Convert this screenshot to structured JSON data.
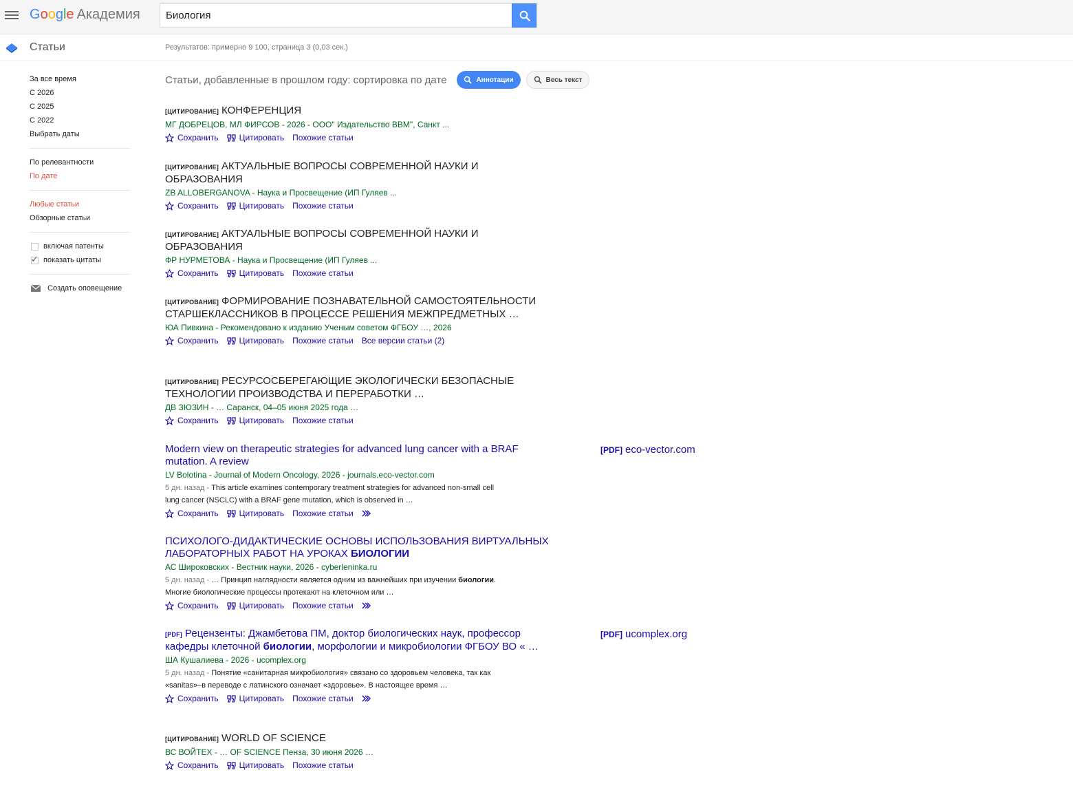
{
  "header": {
    "logo_google": "Google",
    "logo_academy": "Академия",
    "search_value": "Биология"
  },
  "subheader": {
    "title": "Статьи",
    "stats": "Результатов: примерно 9 100, страница 3 (0,03 сек.)"
  },
  "sidebar": {
    "time_items": [
      "За все время",
      "С 2026",
      "С 2025",
      "С 2022",
      "Выбрать даты"
    ],
    "sort_items": [
      "По релевантности",
      "По дате"
    ],
    "type_items": [
      "Любые статьи",
      "Обзорные статьи"
    ],
    "checkboxes": [
      {
        "label": "включая патенты",
        "checked": false
      },
      {
        "label": "показать цитаты",
        "checked": true
      }
    ],
    "alert": "Создать оповещение"
  },
  "sort_line": {
    "text": "Статьи, добавленные в прошлом году: сортировка по дате",
    "abstracts": "Аннотации",
    "fulltext": "Весь текст"
  },
  "actions": {
    "save": "Сохранить",
    "cite": "Цитировать",
    "related": "Похожие статьи",
    "versions": "Все версии статьи (2)"
  },
  "results": [
    {
      "tag": "[ЦИТИРОВАНИЕ]",
      "title": "КОНФЕРЕНЦИЯ",
      "meta": "МГ ДОБРЕЦОВ, МЛ ФИРСОВ - 2026 - ООО\" Издательство ВВМ\", Санкт ..."
    },
    {
      "tag": "[ЦИТИРОВАНИЕ]",
      "title": "АКТУАЛЬНЫЕ ВОПРОСЫ СОВРЕМЕННОЙ НАУКИ И ОБРАЗОВАНИЯ",
      "meta": "ZB ALLOBERGANOVA - Наука и Просвещение (ИП Гуляев ..."
    },
    {
      "tag": "[ЦИТИРОВАНИЕ]",
      "title": "АКТУАЛЬНЫЕ ВОПРОСЫ СОВРЕМЕННОЙ НАУКИ И ОБРАЗОВАНИЯ",
      "meta": "ФР НУРМЕТОВА - Наука и Просвещение (ИП Гуляев ..."
    },
    {
      "tag": "[ЦИТИРОВАНИЕ]",
      "title": "ФОРМИРОВАНИЕ ПОЗНАВАТЕЛЬНОЙ САМОСТОЯТЕЛЬНОСТИ СТАРШЕКЛАССНИКОВ В ПРОЦЕССЕ РЕШЕНИЯ МЕЖПРЕДМЕТНЫХ …",
      "meta": "ЮА Пивкина - Рекомендовано к изданию Ученым советом ФГБОУ …, 2026"
    },
    {
      "tag": "[ЦИТИРОВАНИЕ]",
      "title": "РЕСУРСОСБЕРЕГАЮЩИЕ ЭКОЛОГИЧЕСКИ БЕЗОПАСНЫЕ ТЕХНОЛОГИИ ПРОИЗВОДСТВА И ПЕРЕРАБОТКИ …",
      "meta": "ДВ ЗЮЗИН - … Саранск, 04–05 июня 2025 года …"
    },
    {
      "title": "Modern view on therapeutic strategies for advanced lung cancer with a BRAF mutation. A review",
      "meta": "LV Bolotina - Journal of Modern Oncology, 2026 - journals.eco-vector.com",
      "date": "5 дн. назад - ",
      "snippet": "This article examines contemporary treatment strategies for advanced non-small cell lung cancer (NSCLC) with a BRAF gene mutation, which is observed in …",
      "side_pdf": "[PDF]",
      "side_domain": "eco-vector.com"
    },
    {
      "title_a": "ПСИХОЛОГО-ДИДАКТИЧЕСКИЕ ОСНОВЫ ИСПОЛЬЗОВАНИЯ ВИРТУАЛЬНЫХ ЛАБОРАТОРНЫХ РАБОТ НА УРОКАХ ",
      "title_hl": "БИОЛОГИИ",
      "meta": "АС Широковских - Вестник науки, 2026 - cyberleninka.ru",
      "date": "5 дн. назад - ",
      "snippet_a": "… Принцип наглядности является одним из важнейших при изучении ",
      "snippet_hl": "биологии",
      "snippet_b": ". Многие биологические процессы протекают на клеточном или …"
    },
    {
      "tag": "[PDF]",
      "title_a": "Рецензенты: Джамбетова ПМ, доктор биологических наук, профессор кафедры клеточной ",
      "title_hl": "биологии",
      "title_b": ", морфологии и микробиологии ФГБОУ ВО « …",
      "meta": "ША Кушалиева - 2026 - ucomplex.org",
      "date": "5 дн. назад - ",
      "snippet": "Понятие «санитарная микробиология» связано со здоровьем человека, так как «sanitas»–в переводе с латинского означает «здоровье». В настоящее время …",
      "side_pdf": "[PDF]",
      "side_domain": "ucomplex.org"
    },
    {
      "tag": "[ЦИТИРОВАНИЕ]",
      "title": "WORLD OF SCIENCE",
      "meta": "ВС ВОЙТЕХ - … OF SCIENCE Пенза, 30 июня 2026 …"
    }
  ]
}
